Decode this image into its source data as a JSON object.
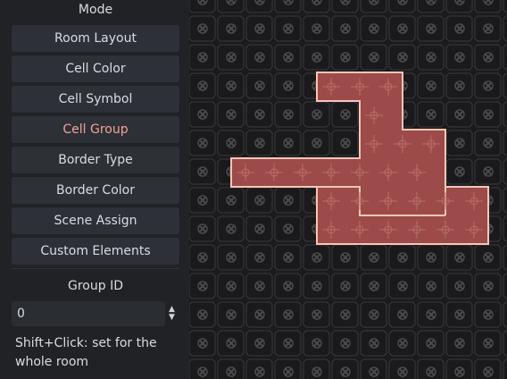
{
  "mode": {
    "title": "Mode",
    "buttons": [
      {
        "label": "Room Layout",
        "active": false
      },
      {
        "label": "Cell Color",
        "active": false
      },
      {
        "label": "Cell Symbol",
        "active": false
      },
      {
        "label": "Cell Group",
        "active": true
      },
      {
        "label": "Border Type",
        "active": false
      },
      {
        "label": "Border Color",
        "active": false
      },
      {
        "label": "Scene Assign",
        "active": false
      },
      {
        "label": "Custom Elements",
        "active": false
      }
    ]
  },
  "group_id": {
    "label": "Group ID",
    "value": "0",
    "hint": "Shift+Click: set for the whole room"
  },
  "colors": {
    "accent_text": "#f0a39a",
    "room_fill": "#9c4a4a",
    "room_border": "#f5c6b4",
    "empty_cell_border": "#3a3a3e"
  }
}
